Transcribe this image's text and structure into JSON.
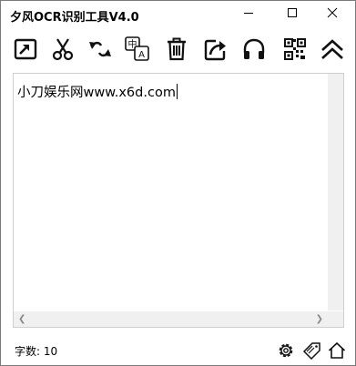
{
  "window": {
    "title": "夕风OCR识别工具V4.0"
  },
  "toolbar": {
    "buttons": [
      {
        "icon": "import-icon",
        "label": "import"
      },
      {
        "icon": "scissors-icon",
        "label": "screenshot"
      },
      {
        "icon": "swap-arrows-icon",
        "label": "convert"
      },
      {
        "icon": "translate-icon",
        "label": "translate"
      },
      {
        "icon": "trash-icon",
        "label": "clear"
      },
      {
        "icon": "share-icon",
        "label": "export"
      },
      {
        "icon": "headphones-icon",
        "label": "read aloud"
      },
      {
        "icon": "qrcode-icon",
        "label": "qr code"
      },
      {
        "icon": "chevron-up-icon",
        "label": "collapse"
      }
    ],
    "translate_glyph_top": "中",
    "translate_glyph_bottom": "A"
  },
  "editor": {
    "text": "小刀娱乐网www.x6d.com"
  },
  "status": {
    "count_label": "字数",
    "count_separator": ": ",
    "count_value": "10"
  },
  "status_icons": [
    "gear-icon",
    "tag-icon",
    "home-icon"
  ]
}
